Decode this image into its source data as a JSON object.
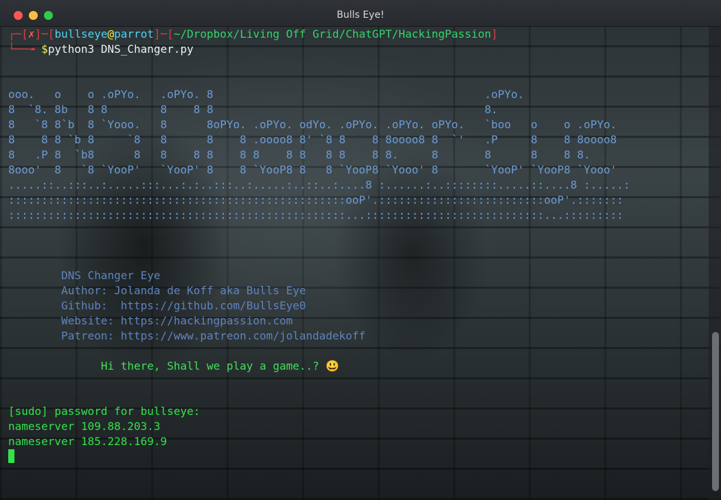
{
  "window": {
    "title": "Bulls Eye!"
  },
  "prompt": {
    "status": "✗",
    "user": "bullseye",
    "at": "@",
    "host": "parrot",
    "path": "~/Dropbox/Living Off Grid/ChatGPT/HackingPassion",
    "dollar": "$",
    "command": "python3 DNS_Changer.py"
  },
  "banner": [
    "ooo.   o    o .oPYo.   .oPYo. 8                                         .oPYo.",
    "8  `8. 8b   8 8        8    8 8                                         8.",
    "8   `8 8`b  8 `Yooo.   8      8oPYo. .oPYo. odYo. .oPYo. .oPYo. oPYo.   `boo   o    o .oPYo.",
    "8    8 8 `b 8     `8   8      8    8 .oooo8 8' `8 8    8 8oooo8 8  `'   .P     8    8 8oooo8",
    "8   .P 8  `b8      8   8    8 8    8 8    8 8   8 8    8 8.     8       8      8    8 8.",
    "8ooo'  8   `8 `YooP'   `YooP' 8    8 `YooP8 8   8 `YooP8 `Yooo' 8       `YooP' `YooP8 `Yooo'",
    ".....::..:::..:.....:::...:.:..:::..:.....:..::..:....8 :......:..::::::::.....::....8 :.....:",
    ":::::::::::::::::::::::::::::::::::::::::::::::::::ooP'.:::::::::::::::::::::::::ooP'.:::::::",
    ":::::::::::::::::::::::::::::::::::::::::::::::::::...:::::::::::::::::::::::::::...:::::::::"
  ],
  "info": {
    "name": "DNS Changer Eye",
    "author": "Author: Jolanda de Koff aka Bulls Eye",
    "github": "Github:  https://github.com/BullsEye0",
    "website": "Website: https://hackingpassion.com",
    "patreon": "Patreon: https://www.patreon.com/jolandadekoff"
  },
  "greeting": "Hi there, Shall we play a game..? 😃",
  "output": {
    "sudo": "[sudo] password for bullseye:",
    "ns1": "nameserver 109.88.203.3",
    "ns2": "nameserver 185.228.169.9"
  }
}
